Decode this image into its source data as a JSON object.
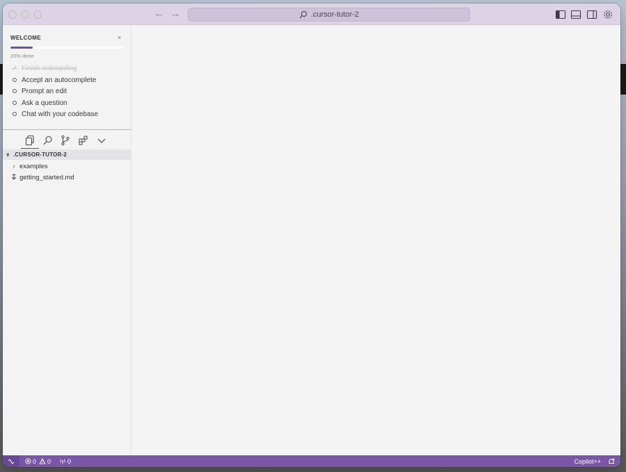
{
  "titlebar": {
    "search_text": ".cursor-tutor-2"
  },
  "welcome": {
    "title": "WELCOME",
    "close_glyph": "×",
    "progress_fraction": 0.2,
    "progress_label": "20% done",
    "tasks": [
      {
        "label": "Finish onboarding",
        "done": true
      },
      {
        "label": "Accept an autocomplete",
        "done": false
      },
      {
        "label": "Prompt an edit",
        "done": false
      },
      {
        "label": "Ask a question",
        "done": false
      },
      {
        "label": "Chat with your codebase",
        "done": false
      }
    ]
  },
  "explorer": {
    "root": ".CURSOR-TUTOR-2",
    "items": [
      {
        "label": "examples",
        "kind": "folder"
      },
      {
        "label": "getting_started.md",
        "kind": "markdown-file"
      }
    ]
  },
  "statusbar": {
    "errors": "0",
    "warnings": "0",
    "ports": "0",
    "copilot_label": "Copilot++"
  },
  "colors": {
    "accent": "#7a55a8",
    "titlebar": "#dcd3e6",
    "progress": "#6f4fa0"
  }
}
